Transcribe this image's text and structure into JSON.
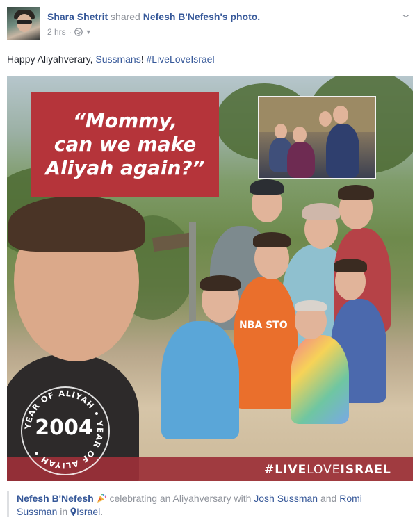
{
  "post": {
    "author": "Shara Shetrit",
    "action": "shared",
    "source_page": "Nefesh B'Nefesh",
    "source_suffix": "'s photo.",
    "time": "2 hrs",
    "separator": "·",
    "audience_icon": "globe-icon",
    "menu_icon": "chevron-down-icon",
    "text_prefix": "Happy Aliyahverary, ",
    "text_mention": "Sussmans",
    "text_mid": "! ",
    "text_hashtag": "#LiveLoveIsrael"
  },
  "image": {
    "quote_line1": "“Mommy,",
    "quote_line2": "can we make",
    "quote_line3": "Aliyah again?”",
    "badge_year": "2004",
    "badge_ring_text": "YEAR OF ALIYAH • YEAR OF ALIYAH •",
    "banner_hashtag_prefix": "#",
    "banner_hashtag_bold1": "LIVE",
    "banner_hashtag_mid": "LOVE",
    "banner_hashtag_bold2": "ISRAEL",
    "shirt_text": "NBA STO"
  },
  "footer": {
    "page": "Nefesh B'Nefesh",
    "feeling_icon": "party-popper-icon",
    "activity": " celebrating an Aliyahversary with ",
    "person1": "Josh Sussman",
    "and": " and ",
    "person2": "Romi Sussman",
    "in": " in ",
    "location_icon": "map-pin-icon",
    "location": "Israel",
    "period": "."
  },
  "colors": {
    "link": "#365899",
    "muted": "#90949c",
    "quote_box": "#b5343a",
    "banner": "#9c3038"
  }
}
